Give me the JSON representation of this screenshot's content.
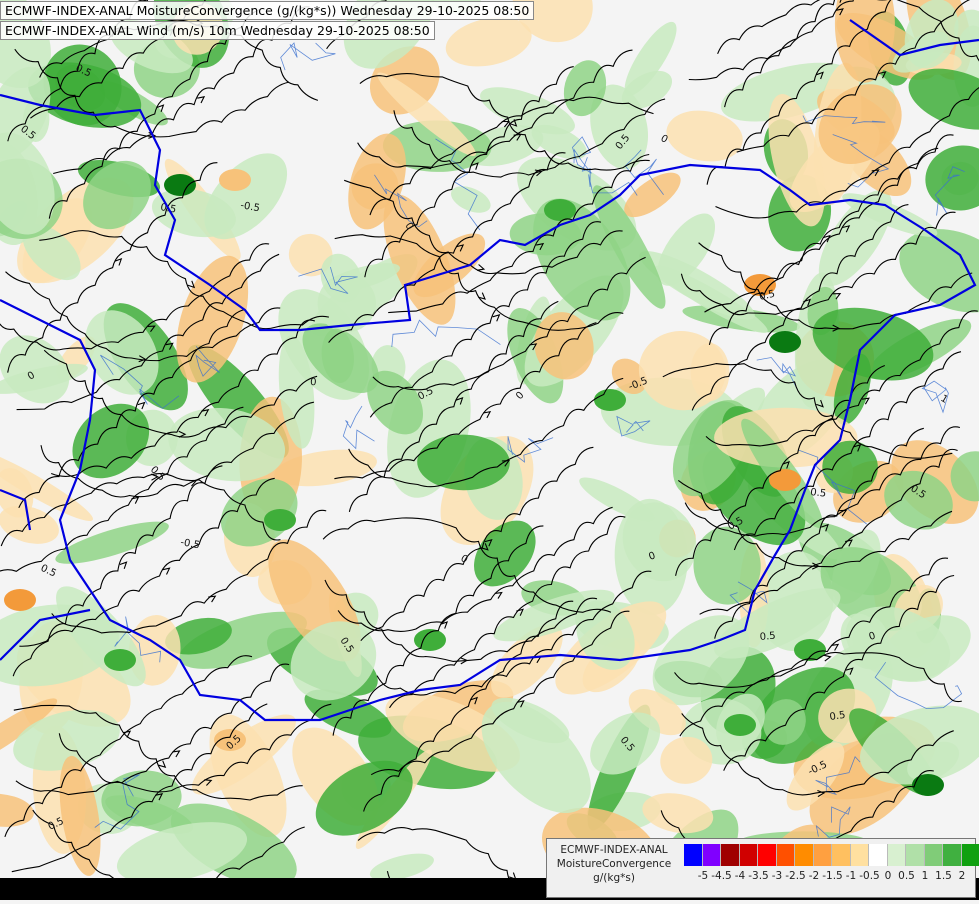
{
  "header": {
    "line1": "ECMWF-INDEX-ANAL MoistureConvergence (g/(kg*s)) Wednesday 29-10-2025 08:50",
    "line2": "ECMWF-INDEX-ANAL Wind (m/s) 10m Wednesday 29-10-2025 08:50"
  },
  "map": {
    "contour_label": "0.5",
    "contour_label_neg": "-0.5",
    "contour_zero": "0",
    "contour_one": "1",
    "colors": {
      "border": "#0000e0",
      "river": "#3a6fd0",
      "streamline": "#000000",
      "pos_light": "#c8eac0",
      "pos_mid": "#8fd486",
      "pos_strong": "#3fae3a",
      "pos_max": "#0a7a12",
      "neg_light": "#fbe0b0",
      "neg_mid": "#f7c27a",
      "neg_strong": "#f39a3a"
    }
  },
  "legend": {
    "title_lines": [
      "ECMWF-INDEX-ANAL",
      "MoistureConvergence",
      "g/(kg*s)"
    ],
    "swatches": [
      "#0000ff",
      "#8000ff",
      "#a00000",
      "#d00000",
      "#ff0000",
      "#ff5000",
      "#ff8c00",
      "#ffa040",
      "#ffc060",
      "#ffe0a0",
      "#ffffff",
      "#d8f0d0",
      "#b0e0a8",
      "#80cc78",
      "#40b040",
      "#10a010"
    ],
    "ticks": [
      "-5",
      "-4.5",
      "-4",
      "-3.5",
      "-3",
      "-2.5",
      "-2",
      "-1.5",
      "-1",
      "-0.5",
      "0",
      "0.5",
      "1",
      "1.5",
      "2"
    ]
  }
}
